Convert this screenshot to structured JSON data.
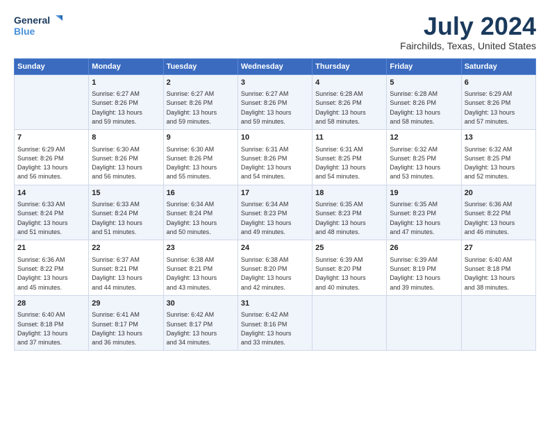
{
  "header": {
    "logo_line1": "General",
    "logo_line2": "Blue",
    "title": "July 2024",
    "subtitle": "Fairchilds, Texas, United States"
  },
  "days": [
    "Sunday",
    "Monday",
    "Tuesday",
    "Wednesday",
    "Thursday",
    "Friday",
    "Saturday"
  ],
  "weeks": [
    [
      {
        "date": "",
        "info": ""
      },
      {
        "date": "1",
        "info": "Sunrise: 6:27 AM\nSunset: 8:26 PM\nDaylight: 13 hours\nand 59 minutes."
      },
      {
        "date": "2",
        "info": "Sunrise: 6:27 AM\nSunset: 8:26 PM\nDaylight: 13 hours\nand 59 minutes."
      },
      {
        "date": "3",
        "info": "Sunrise: 6:27 AM\nSunset: 8:26 PM\nDaylight: 13 hours\nand 59 minutes."
      },
      {
        "date": "4",
        "info": "Sunrise: 6:28 AM\nSunset: 8:26 PM\nDaylight: 13 hours\nand 58 minutes."
      },
      {
        "date": "5",
        "info": "Sunrise: 6:28 AM\nSunset: 8:26 PM\nDaylight: 13 hours\nand 58 minutes."
      },
      {
        "date": "6",
        "info": "Sunrise: 6:29 AM\nSunset: 8:26 PM\nDaylight: 13 hours\nand 57 minutes."
      }
    ],
    [
      {
        "date": "7",
        "info": "Sunrise: 6:29 AM\nSunset: 8:26 PM\nDaylight: 13 hours\nand 56 minutes."
      },
      {
        "date": "8",
        "info": "Sunrise: 6:30 AM\nSunset: 8:26 PM\nDaylight: 13 hours\nand 56 minutes."
      },
      {
        "date": "9",
        "info": "Sunrise: 6:30 AM\nSunset: 8:26 PM\nDaylight: 13 hours\nand 55 minutes."
      },
      {
        "date": "10",
        "info": "Sunrise: 6:31 AM\nSunset: 8:26 PM\nDaylight: 13 hours\nand 54 minutes."
      },
      {
        "date": "11",
        "info": "Sunrise: 6:31 AM\nSunset: 8:25 PM\nDaylight: 13 hours\nand 54 minutes."
      },
      {
        "date": "12",
        "info": "Sunrise: 6:32 AM\nSunset: 8:25 PM\nDaylight: 13 hours\nand 53 minutes."
      },
      {
        "date": "13",
        "info": "Sunrise: 6:32 AM\nSunset: 8:25 PM\nDaylight: 13 hours\nand 52 minutes."
      }
    ],
    [
      {
        "date": "14",
        "info": "Sunrise: 6:33 AM\nSunset: 8:24 PM\nDaylight: 13 hours\nand 51 minutes."
      },
      {
        "date": "15",
        "info": "Sunrise: 6:33 AM\nSunset: 8:24 PM\nDaylight: 13 hours\nand 51 minutes."
      },
      {
        "date": "16",
        "info": "Sunrise: 6:34 AM\nSunset: 8:24 PM\nDaylight: 13 hours\nand 50 minutes."
      },
      {
        "date": "17",
        "info": "Sunrise: 6:34 AM\nSunset: 8:23 PM\nDaylight: 13 hours\nand 49 minutes."
      },
      {
        "date": "18",
        "info": "Sunrise: 6:35 AM\nSunset: 8:23 PM\nDaylight: 13 hours\nand 48 minutes."
      },
      {
        "date": "19",
        "info": "Sunrise: 6:35 AM\nSunset: 8:23 PM\nDaylight: 13 hours\nand 47 minutes."
      },
      {
        "date": "20",
        "info": "Sunrise: 6:36 AM\nSunset: 8:22 PM\nDaylight: 13 hours\nand 46 minutes."
      }
    ],
    [
      {
        "date": "21",
        "info": "Sunrise: 6:36 AM\nSunset: 8:22 PM\nDaylight: 13 hours\nand 45 minutes."
      },
      {
        "date": "22",
        "info": "Sunrise: 6:37 AM\nSunset: 8:21 PM\nDaylight: 13 hours\nand 44 minutes."
      },
      {
        "date": "23",
        "info": "Sunrise: 6:38 AM\nSunset: 8:21 PM\nDaylight: 13 hours\nand 43 minutes."
      },
      {
        "date": "24",
        "info": "Sunrise: 6:38 AM\nSunset: 8:20 PM\nDaylight: 13 hours\nand 42 minutes."
      },
      {
        "date": "25",
        "info": "Sunrise: 6:39 AM\nSunset: 8:20 PM\nDaylight: 13 hours\nand 40 minutes."
      },
      {
        "date": "26",
        "info": "Sunrise: 6:39 AM\nSunset: 8:19 PM\nDaylight: 13 hours\nand 39 minutes."
      },
      {
        "date": "27",
        "info": "Sunrise: 6:40 AM\nSunset: 8:18 PM\nDaylight: 13 hours\nand 38 minutes."
      }
    ],
    [
      {
        "date": "28",
        "info": "Sunrise: 6:40 AM\nSunset: 8:18 PM\nDaylight: 13 hours\nand 37 minutes."
      },
      {
        "date": "29",
        "info": "Sunrise: 6:41 AM\nSunset: 8:17 PM\nDaylight: 13 hours\nand 36 minutes."
      },
      {
        "date": "30",
        "info": "Sunrise: 6:42 AM\nSunset: 8:17 PM\nDaylight: 13 hours\nand 34 minutes."
      },
      {
        "date": "31",
        "info": "Sunrise: 6:42 AM\nSunset: 8:16 PM\nDaylight: 13 hours\nand 33 minutes."
      },
      {
        "date": "",
        "info": ""
      },
      {
        "date": "",
        "info": ""
      },
      {
        "date": "",
        "info": ""
      }
    ]
  ]
}
